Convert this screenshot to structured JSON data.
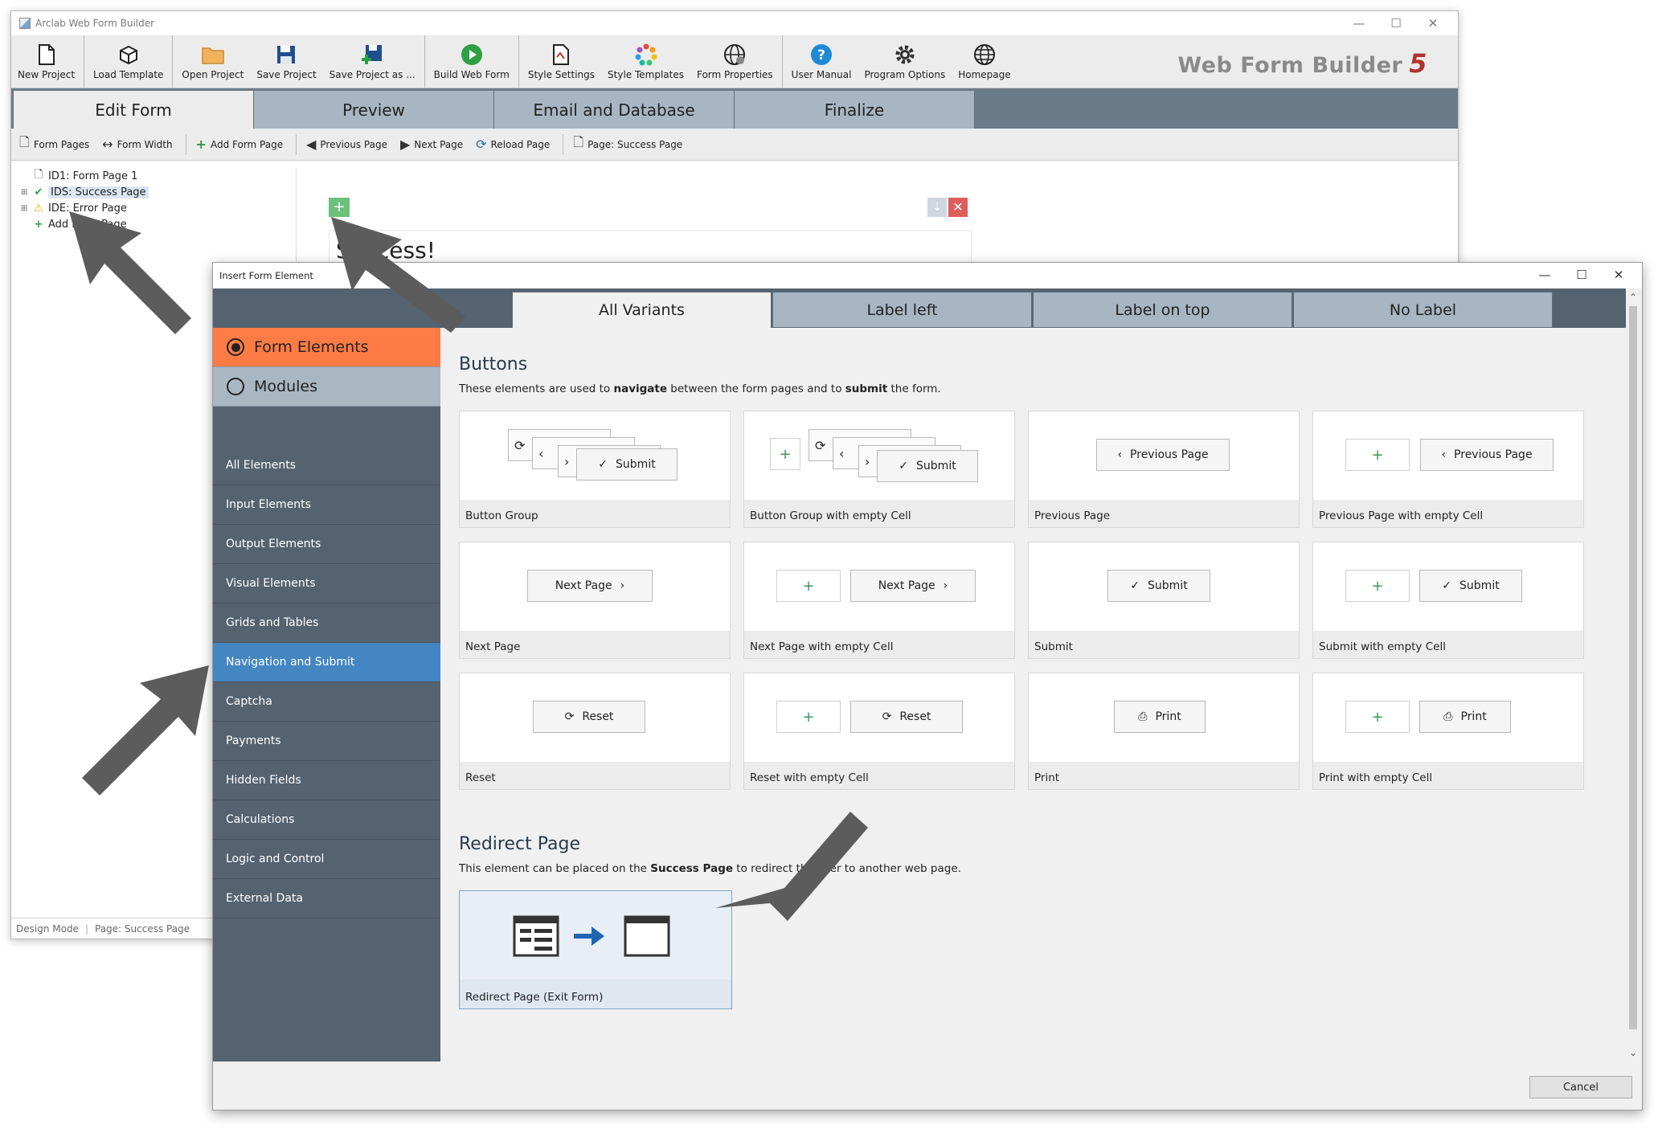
{
  "main_window": {
    "title": "Arclab Web Form Builder",
    "controls": [
      "—",
      "☐",
      "✕"
    ],
    "toolbar": [
      {
        "label": "New Project",
        "icon": "new-document-icon"
      },
      {
        "label": "Load Template",
        "icon": "template-box-icon"
      },
      {
        "label": "Open Project",
        "icon": "folder-icon"
      },
      {
        "label": "Save Project",
        "icon": "floppy-icon"
      },
      {
        "label": "Save Project as ...",
        "icon": "floppy-plus-icon"
      },
      {
        "label": "Build Web Form",
        "icon": "play-icon"
      },
      {
        "label": "Style Settings",
        "icon": "style-document-icon"
      },
      {
        "label": "Style Templates",
        "icon": "color-wheel-icon"
      },
      {
        "label": "Form Properties",
        "icon": "globe-gear-icon"
      },
      {
        "label": "User Manual",
        "icon": "help-icon"
      },
      {
        "label": "Program Options",
        "icon": "gear-icon"
      },
      {
        "label": "Homepage",
        "icon": "globe-icon"
      }
    ],
    "brand": {
      "name": "Web Form Builder",
      "version": "5"
    },
    "tabs": [
      "Edit Form",
      "Preview",
      "Email and Database",
      "Finalize"
    ],
    "subtoolbar": [
      "Form Pages",
      "Form Width",
      "Add Form Page",
      "Previous Page",
      "Next Page",
      "Reload Page",
      "Page: Success Page"
    ],
    "tree": [
      {
        "label": "ID1: Form Page 1",
        "icon": "page-icon"
      },
      {
        "label": "IDS: Success Page",
        "icon": "check-circle-icon"
      },
      {
        "label": "IDE: Error Page",
        "icon": "warning-icon"
      },
      {
        "label": "Add Form Page",
        "icon": "plus-icon"
      }
    ],
    "canvas": {
      "heading": "Success!"
    },
    "status": {
      "mode": "Design Mode",
      "page": "Page: Success Page"
    }
  },
  "dialog": {
    "title": "Insert Form Element",
    "variant_tabs": [
      "All Variants",
      "Label left",
      "Label on top",
      "No Label"
    ],
    "radio": [
      "Form Elements",
      "Modules"
    ],
    "categories": [
      "All Elements",
      "Input Elements",
      "Output Elements",
      "Visual Elements",
      "Grids and Tables",
      "Navigation and Submit",
      "Captcha",
      "Payments",
      "Hidden Fields",
      "Calculations",
      "Logic and Control",
      "External Data"
    ],
    "buttons_section": {
      "title": "Buttons",
      "desc_1": "These elements are used to ",
      "desc_b1": "navigate",
      "desc_2": " between the form pages and to ",
      "desc_b2": "submit",
      "desc_3": " the form."
    },
    "cards": [
      "Button Group",
      "Button Group with empty Cell",
      "Previous Page",
      "Previous Page with empty Cell",
      "Next Page",
      "Next Page with empty Cell",
      "Submit",
      "Submit with empty Cell",
      "Reset",
      "Reset with empty Cell",
      "Print",
      "Print with empty Cell"
    ],
    "preview_labels": {
      "submit": "Submit",
      "previous": "Previous Page",
      "next": "Next Page",
      "reset": "Reset",
      "print": "Print",
      "plus": "+"
    },
    "redirect_section": {
      "title": "Redirect Page",
      "desc_1": "This element can be placed on the ",
      "desc_b": "Success Page",
      "desc_2": " to redirect the user to another web page.",
      "card": "Redirect Page (Exit Form)"
    },
    "cancel": "Cancel"
  },
  "colors": {
    "accent_orange": "#ff7b45",
    "sidebar_dark": "#556370",
    "selected_blue": "#4486c2",
    "tab_inactive": "#a7b6c2"
  }
}
